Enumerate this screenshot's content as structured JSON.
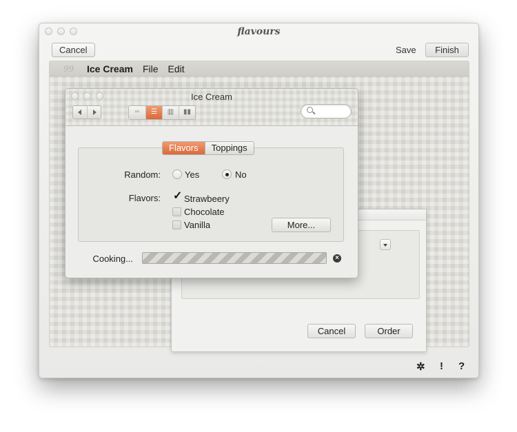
{
  "outer_window": {
    "title": "flavours",
    "cancel_label": "Cancel",
    "save_label": "Save",
    "finish_label": "Finish"
  },
  "menubar": {
    "logo": "99",
    "app_name": "Ice Cream",
    "menus": [
      "File",
      "Edit"
    ]
  },
  "dialog": {
    "title": "Ice Cream",
    "tabs": [
      {
        "label": "Flavors",
        "active": true
      },
      {
        "label": "Toppings",
        "active": false
      }
    ],
    "random": {
      "label": "Random:",
      "options": [
        {
          "label": "Yes",
          "selected": false
        },
        {
          "label": "No",
          "selected": true
        }
      ]
    },
    "flavors": {
      "label": "Flavors:",
      "items": [
        {
          "label": "Strawbeery",
          "checked": true
        },
        {
          "label": "Chocolate",
          "checked": false
        },
        {
          "label": "Vanilla",
          "checked": false
        }
      ],
      "more_label": "More..."
    },
    "progress": {
      "label": "Cooking..."
    }
  },
  "back_dialog": {
    "cancel_label": "Cancel",
    "order_label": "Order"
  },
  "bottom_bar": {
    "icons": [
      "gear-icon",
      "alert-icon",
      "help-icon"
    ],
    "gear_glyph": "✲",
    "alert_glyph": "!",
    "help_glyph": "?"
  },
  "colors": {
    "accent": "#e07a4a"
  }
}
